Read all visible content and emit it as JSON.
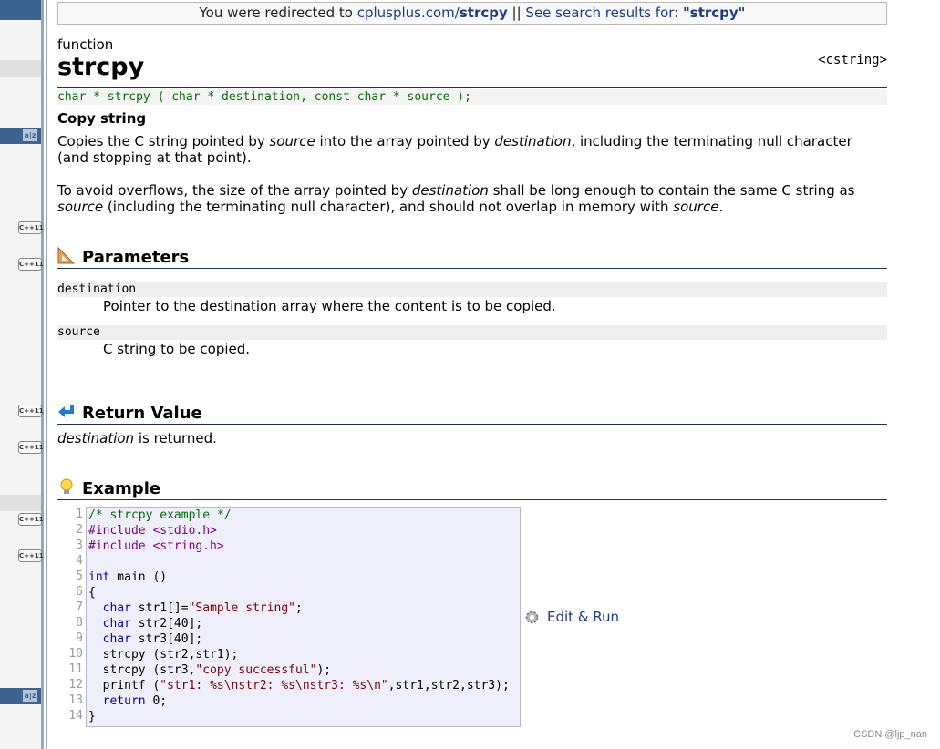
{
  "banner": {
    "prefix": "You were redirected to ",
    "link_domain": "cplusplus.com/",
    "link_name": "strcpy",
    "separator": " || ",
    "search_text": "See search results for: ",
    "search_term": "\"strcpy\""
  },
  "page": {
    "kind": "function",
    "title": "strcpy",
    "header_tag": "<cstring>",
    "prototype": "char * strcpy ( char * destination, const char * source );",
    "subtitle": "Copy string"
  },
  "description": {
    "p1_a": "Copies the C string pointed by ",
    "p1_b": "source",
    "p1_c": " into the array pointed by ",
    "p1_d": "destination",
    "p1_e": ", including the terminating null character (and stopping at that point).",
    "p2_a": "To avoid overflows, the size of the array pointed by ",
    "p2_b": "destination",
    "p2_c": " shall be long enough to contain the same C string as ",
    "p2_d": "source",
    "p2_e": " (including the terminating null character), and should not overlap in memory with ",
    "p2_f": "source",
    "p2_g": "."
  },
  "sections": {
    "parameters": "Parameters",
    "return_value": "Return Value",
    "example": "Example"
  },
  "parameters": [
    {
      "name": "destination",
      "desc": "Pointer to the destination array where the content is to be copied."
    },
    {
      "name": "source",
      "desc": "C string to be copied."
    }
  ],
  "return_value": {
    "a": "destination",
    "b": " is returned."
  },
  "example": {
    "line_numbers": [
      "1",
      "2",
      "3",
      "4",
      "5",
      "6",
      "7",
      "8",
      "9",
      "10",
      "11",
      "12",
      "13",
      "14"
    ],
    "lines": [
      {
        "parts": [
          {
            "t": "/* strcpy example */",
            "c": "cm"
          }
        ]
      },
      {
        "parts": [
          {
            "t": "#include <stdio.h>",
            "c": "pp"
          }
        ]
      },
      {
        "parts": [
          {
            "t": "#include <string.h>",
            "c": "pp"
          }
        ]
      },
      {
        "parts": [
          {
            "t": "",
            "c": ""
          }
        ]
      },
      {
        "parts": [
          {
            "t": "int",
            "c": "kw"
          },
          {
            "t": " main ()",
            "c": ""
          }
        ]
      },
      {
        "parts": [
          {
            "t": "{",
            "c": ""
          }
        ]
      },
      {
        "parts": [
          {
            "t": "  ",
            "c": ""
          },
          {
            "t": "char",
            "c": "kw"
          },
          {
            "t": " str1[]=",
            "c": ""
          },
          {
            "t": "\"Sample string\"",
            "c": "st"
          },
          {
            "t": ";",
            "c": ""
          }
        ]
      },
      {
        "parts": [
          {
            "t": "  ",
            "c": ""
          },
          {
            "t": "char",
            "c": "kw"
          },
          {
            "t": " str2[40];",
            "c": ""
          }
        ]
      },
      {
        "parts": [
          {
            "t": "  ",
            "c": ""
          },
          {
            "t": "char",
            "c": "kw"
          },
          {
            "t": " str3[40];",
            "c": ""
          }
        ]
      },
      {
        "parts": [
          {
            "t": "  strcpy (str2,str1);",
            "c": ""
          }
        ]
      },
      {
        "parts": [
          {
            "t": "  strcpy (str3,",
            "c": ""
          },
          {
            "t": "\"copy successful\"",
            "c": "st"
          },
          {
            "t": ");",
            "c": ""
          }
        ]
      },
      {
        "parts": [
          {
            "t": "  printf (",
            "c": ""
          },
          {
            "t": "\"str1: %s\\nstr2: %s\\nstr3: %s\\n\"",
            "c": "st"
          },
          {
            "t": ",str1,str2,str3);",
            "c": ""
          }
        ]
      },
      {
        "parts": [
          {
            "t": "  ",
            "c": ""
          },
          {
            "t": "return",
            "c": "kw"
          },
          {
            "t": " 0;",
            "c": ""
          }
        ]
      },
      {
        "parts": [
          {
            "t": "}",
            "c": ""
          }
        ]
      }
    ],
    "edit_run": "Edit & Run"
  },
  "sidebar": {
    "az_label": "a|z",
    "cpp_label": "C++11"
  },
  "watermark": "CSDN @ljp_nan"
}
